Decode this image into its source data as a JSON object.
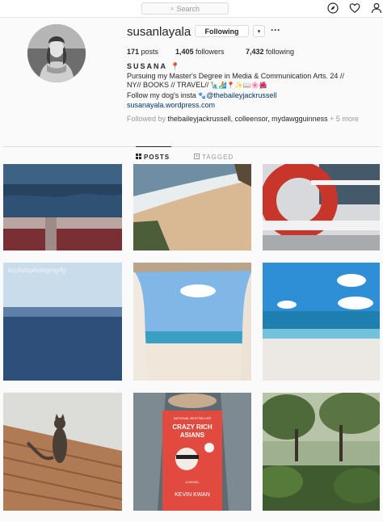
{
  "topbar": {
    "search_placeholder": "Search",
    "icons": [
      "compass-icon",
      "heart-icon",
      "person-icon"
    ]
  },
  "profile": {
    "username": "susanlayala",
    "following_button": "Following",
    "dropdown_glyph": "▾",
    "more_glyph": "···",
    "stats": {
      "posts_count": "171",
      "posts_label": "posts",
      "followers_count": "1,405",
      "followers_label": "followers",
      "following_count": "7,432",
      "following_label": "following"
    },
    "bio": {
      "name": "SUSANA",
      "line1": "Pursuing my Master's Degree in Media & Communication Arts. 24 //",
      "line2": "NY// BOOKS // TRAVEL//",
      "line3_prefix": "Follow my dog's insta",
      "line3_handle": "@thebaileyjackrussell",
      "website": "susanayala.wordpress.com"
    },
    "followed_by": {
      "prefix": "Followed by",
      "names": "thebaileyjackrussell, colleensor, mydawgguinness",
      "suffix": "+ 5 more"
    }
  },
  "tabs": {
    "posts": "POSTS",
    "tagged": "TAGGED"
  },
  "posts": {
    "p1": "ocean with red railing",
    "p2": "aerial beach and waves",
    "p3": "red life ring on boat",
    "p4": "calm ocean horizon",
    "p4_watermark": "kaylalaphotography",
    "p5": "beach through curtains",
    "p6": "blue sky beach",
    "p7": "cat on wooden deck",
    "p8": "book on lap",
    "p9": "park with trees",
    "book": {
      "tag": "NATIONAL BESTSELLER",
      "title1": "CRAZY RICH",
      "title2": "ASIANS",
      "subtitle": "A NOVEL",
      "author": "KEVIN KWAN"
    }
  },
  "colors": {
    "link": "#003569",
    "border": "#dbdbdb",
    "muted": "#999999",
    "text": "#262626"
  }
}
